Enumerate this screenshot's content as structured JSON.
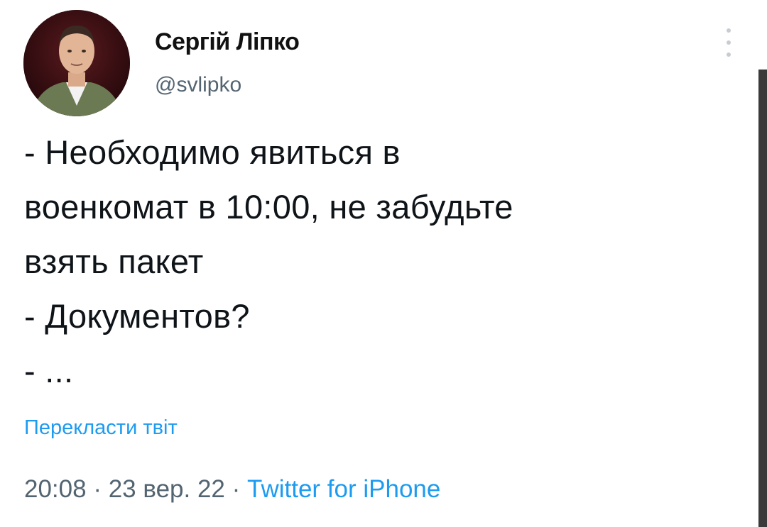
{
  "author": {
    "display_name": "Сергій Ліпко",
    "handle": "@svlipko",
    "avatar_icon": "profile-photo"
  },
  "tweet": {
    "lines": [
      "- Необходимо явиться в",
      "военкомат в 10:00, не забудьте",
      "взять пакет",
      "- Документов?",
      "- ..."
    ],
    "translate_label": "Перекласти твіт",
    "time": "20:08",
    "separator": "·",
    "date": "23 вер. 22",
    "source": "Twitter for iPhone"
  },
  "menu": {
    "icon": "more-vertical-icon"
  },
  "colors": {
    "link": "#1d9bf0",
    "secondary_text": "#536471",
    "primary_text": "#0f1419"
  }
}
